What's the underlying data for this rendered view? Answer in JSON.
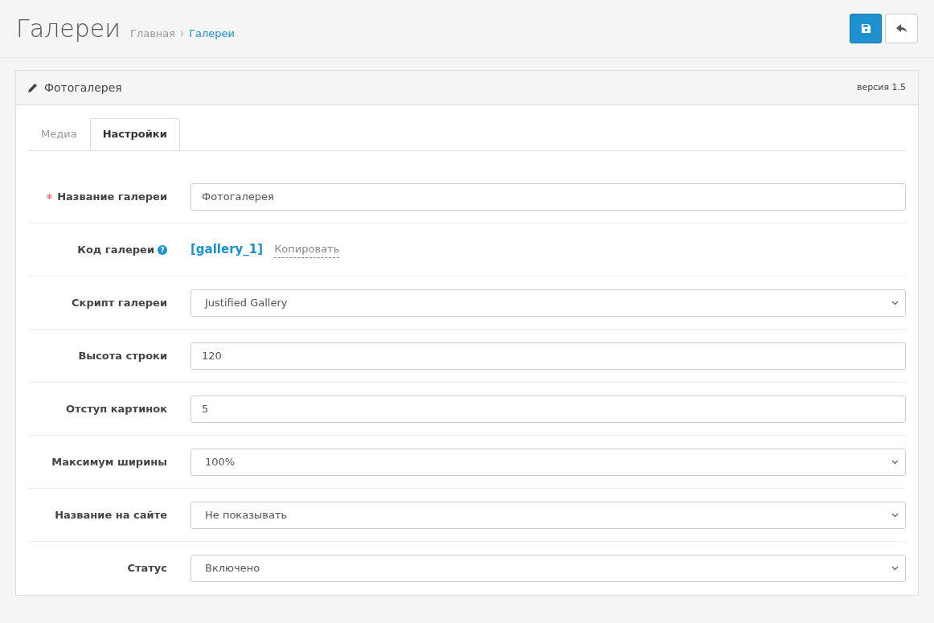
{
  "page": {
    "title": "Галереи",
    "breadcrumbs": [
      {
        "label": "Главная",
        "current": false
      },
      {
        "label": "Галереи",
        "current": true
      }
    ]
  },
  "panel": {
    "title": "Фотогалерея",
    "version": "версия 1.5"
  },
  "tabs": [
    {
      "label": "Медиа",
      "selected": false
    },
    {
      "label": "Настройки",
      "selected": true
    }
  ],
  "fields": [
    {
      "kind": "text",
      "label": "Название галереи",
      "required": true,
      "value": "Фотогалерея"
    },
    {
      "kind": "code",
      "label": "Код галереи",
      "required": false,
      "help": "?",
      "value": "[gallery_1]",
      "action": "Копировать"
    },
    {
      "kind": "select",
      "label": "Скрипт галереи",
      "required": false,
      "value": "Justified Gallery"
    },
    {
      "kind": "text",
      "label": "Высота строки",
      "required": false,
      "value": "120"
    },
    {
      "kind": "text",
      "label": "Отступ картинок",
      "required": false,
      "value": "5"
    },
    {
      "kind": "select",
      "label": "Максимум ширины",
      "required": false,
      "value": "100%"
    },
    {
      "kind": "select",
      "label": "Название на сайте",
      "required": false,
      "value": "Не показывать"
    },
    {
      "kind": "select",
      "label": "Статус",
      "required": false,
      "value": "Включено"
    }
  ]
}
